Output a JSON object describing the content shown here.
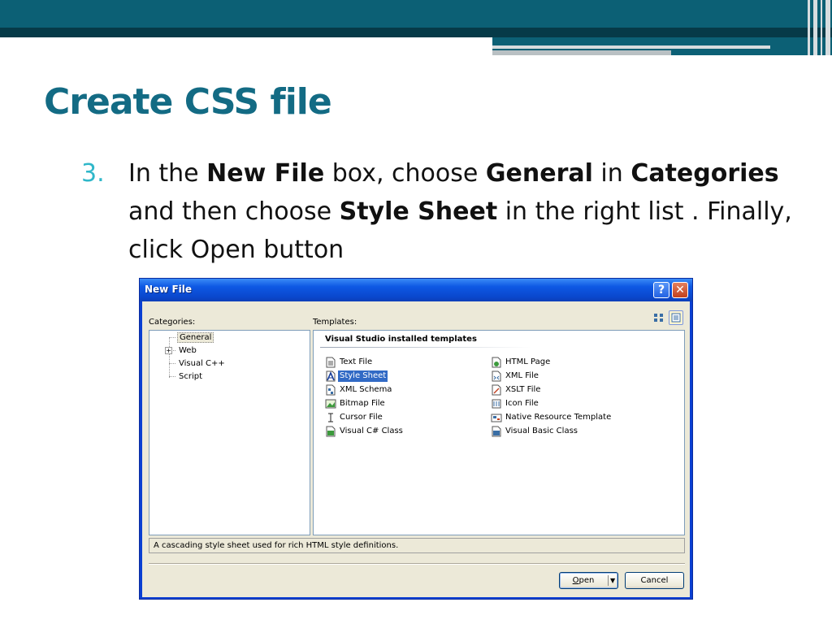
{
  "slide": {
    "title": "Create CSS file",
    "bullet": {
      "number": "3.",
      "segments": [
        {
          "text": "In the ",
          "bold": false
        },
        {
          "text": "New File",
          "bold": true
        },
        {
          "text": " box, choose ",
          "bold": false
        },
        {
          "text": "General",
          "bold": true
        },
        {
          "text": " in ",
          "bold": false
        },
        {
          "text": "Categories",
          "bold": true
        },
        {
          "text": " and then choose ",
          "bold": false
        },
        {
          "text": "Style Sheet",
          "bold": true
        },
        {
          "text": " in the right list . Finally, click Open button",
          "bold": false
        }
      ]
    }
  },
  "dialog": {
    "title": "New File",
    "help_glyph": "?",
    "close_glyph": "✕",
    "categories_label": "Categories:",
    "templates_label": "Templates:",
    "categories": [
      {
        "label": "General",
        "selected": true,
        "expandable": false
      },
      {
        "label": "Web",
        "selected": false,
        "expandable": true
      },
      {
        "label": "Visual C++",
        "selected": false,
        "expandable": false
      },
      {
        "label": "Script",
        "selected": false,
        "expandable": false
      }
    ],
    "expander_glyph": "+",
    "templates_header": "Visual Studio installed templates",
    "templates_left": [
      {
        "label": "Text File",
        "icon": "text-file-icon",
        "selected": false
      },
      {
        "label": "Style Sheet",
        "icon": "style-sheet-icon",
        "selected": true
      },
      {
        "label": "XML Schema",
        "icon": "xml-schema-icon",
        "selected": false
      },
      {
        "label": "Bitmap File",
        "icon": "bitmap-file-icon",
        "selected": false
      },
      {
        "label": "Cursor File",
        "icon": "cursor-file-icon",
        "selected": false
      },
      {
        "label": "Visual C# Class",
        "icon": "csharp-class-icon",
        "selected": false
      }
    ],
    "templates_right": [
      {
        "label": "HTML Page",
        "icon": "html-page-icon",
        "selected": false
      },
      {
        "label": "XML File",
        "icon": "xml-file-icon",
        "selected": false
      },
      {
        "label": "XSLT File",
        "icon": "xslt-file-icon",
        "selected": false
      },
      {
        "label": "Icon File",
        "icon": "icon-file-icon",
        "selected": false
      },
      {
        "label": "Native Resource Template",
        "icon": "native-resource-icon",
        "selected": false
      },
      {
        "label": "Visual Basic Class",
        "icon": "vb-class-icon",
        "selected": false
      }
    ],
    "description": "A cascading style sheet used for rich HTML style definitions.",
    "open_label_accel": "O",
    "open_label_rest": "pen",
    "dropdown_glyph": "▼",
    "cancel_label": "Cancel"
  },
  "colors": {
    "header_band": "#0c6075",
    "title": "#136b84",
    "bullet_number": "#2fb7c9",
    "selection": "#316ac5"
  }
}
